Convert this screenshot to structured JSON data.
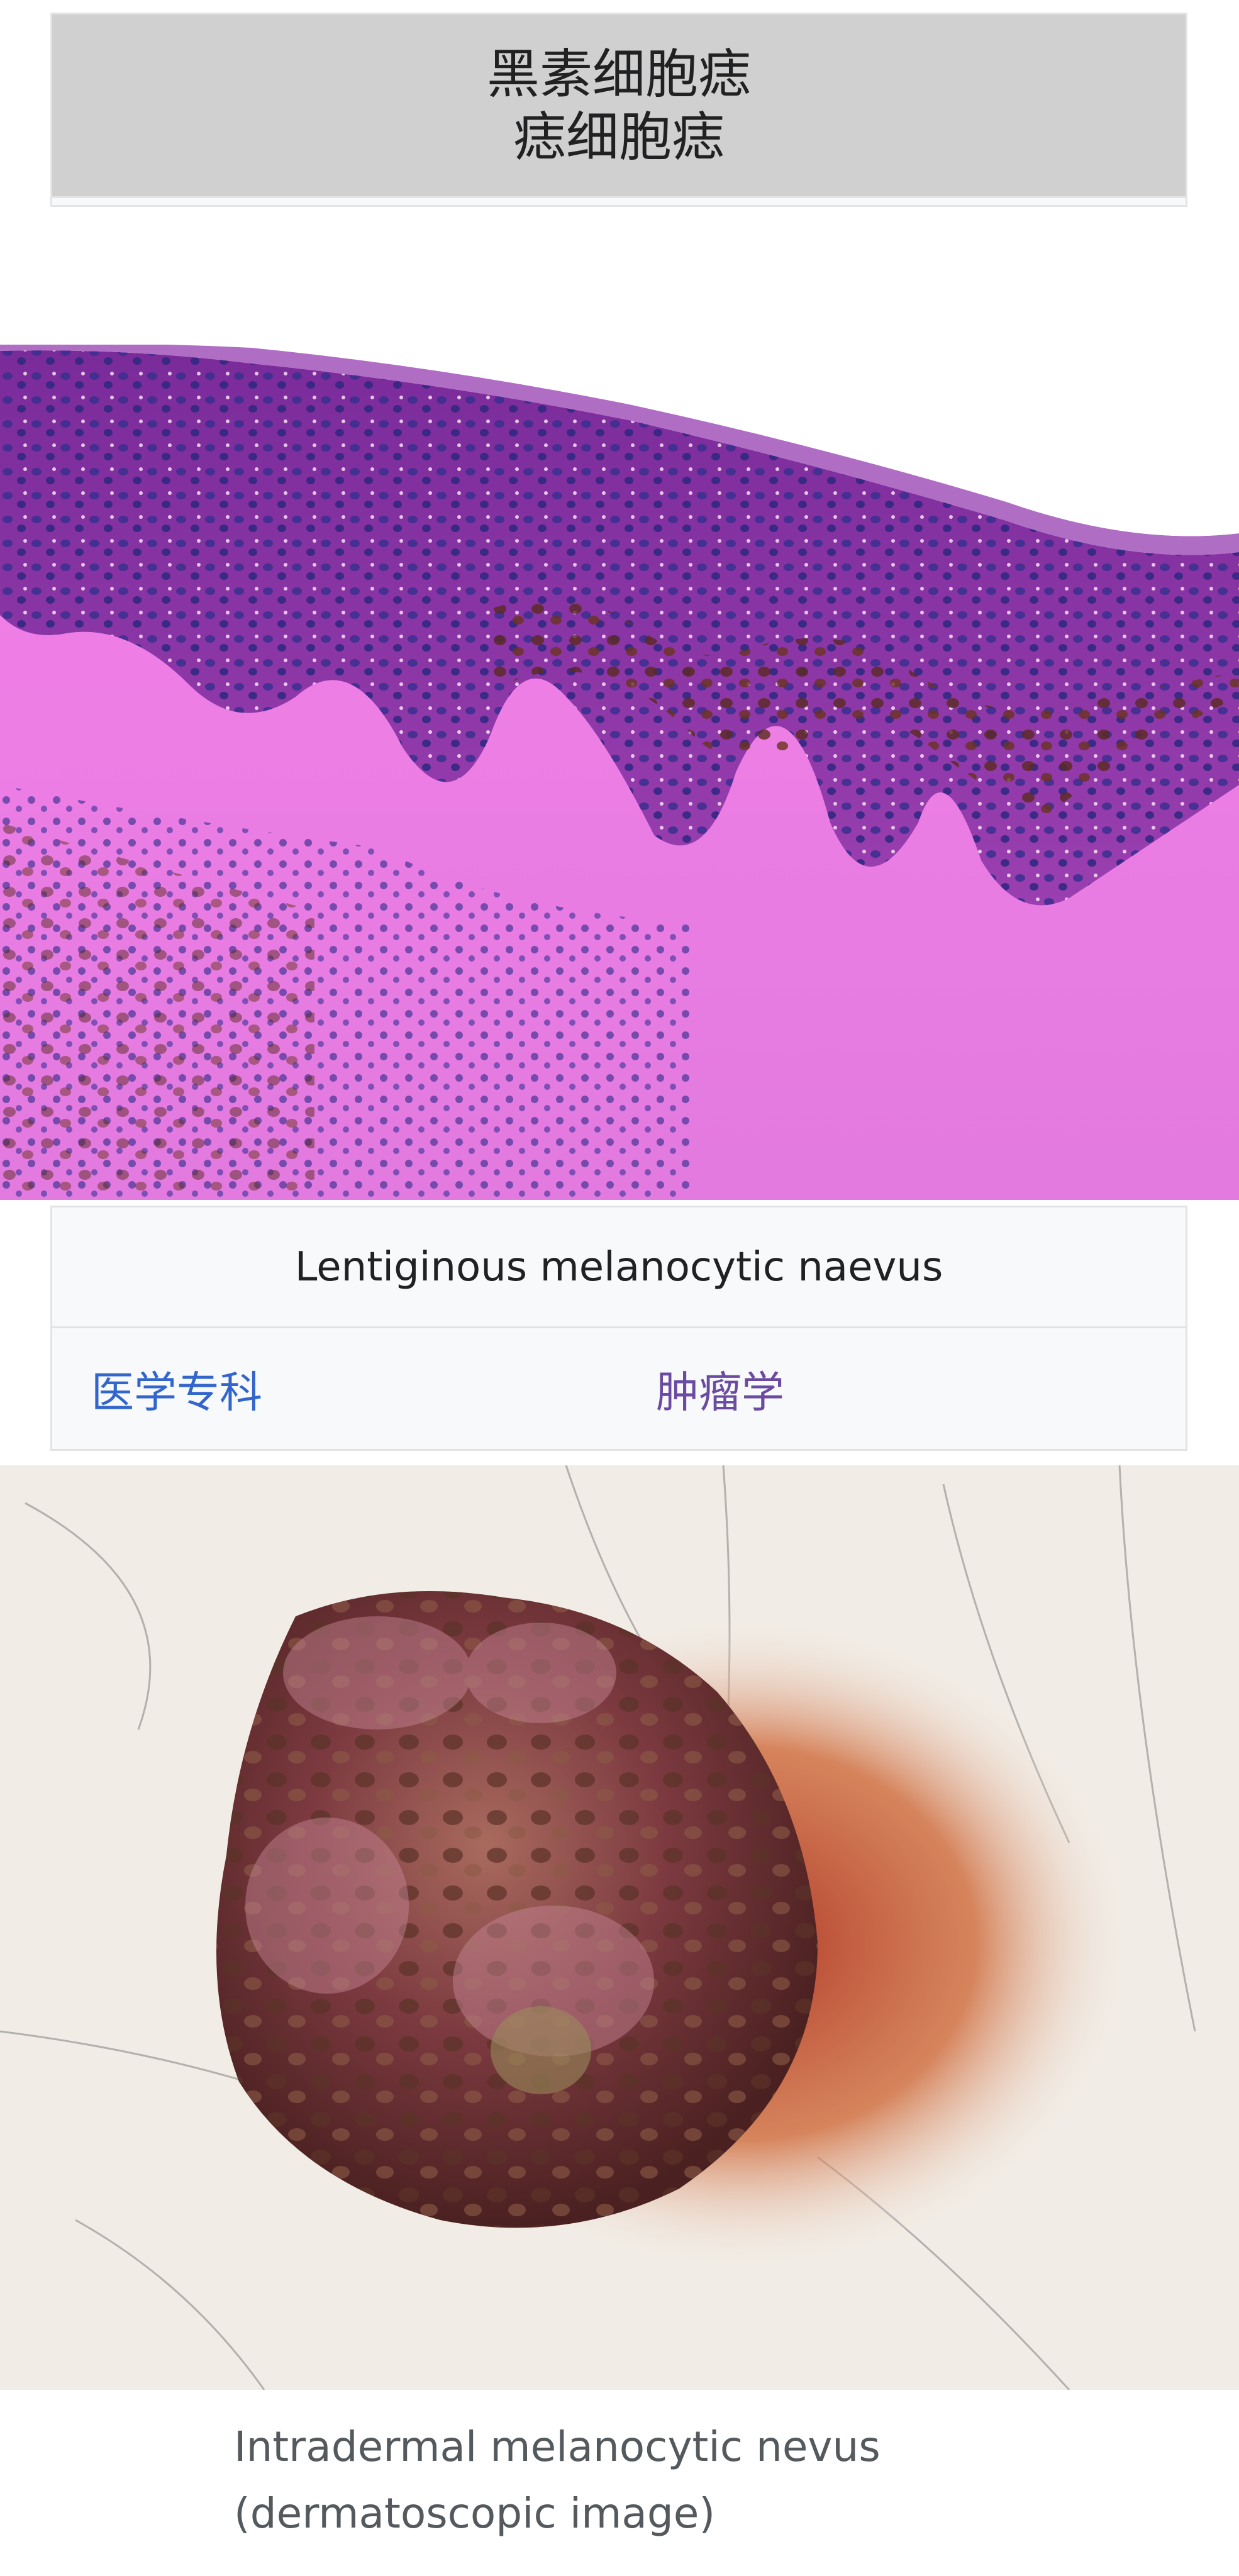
{
  "infobox": {
    "title_line1": "黑素细胞痣",
    "title_line2": "痣细胞痣"
  },
  "images": {
    "histology": {
      "icon": "histology-micrograph-image",
      "colors": {
        "epidermis": "#8a2fa0",
        "nuclei": "#2a2f8a",
        "dermis": "#e98ae0",
        "pigment": "#5a2a1a"
      }
    },
    "dermoscopy": {
      "icon": "dermatoscopic-photo-image",
      "colors": {
        "skin": "#f3eee8",
        "lesion": "#7a2a3a",
        "halo": "#d0623a"
      }
    }
  },
  "caption": "Lentiginous melanocytic naevus",
  "specialty": {
    "label": "医学专科",
    "value": "肿瘤学"
  },
  "bottom_caption": {
    "line1": "Intradermal melanocytic nevus",
    "line2": "(dermatoscopic image)"
  },
  "colors": {
    "link": "#3366cc",
    "visited_link": "#6b4ba1",
    "title_bg": "#d0d0d0",
    "row_bg": "#f8f9fa",
    "text": "#202122"
  }
}
